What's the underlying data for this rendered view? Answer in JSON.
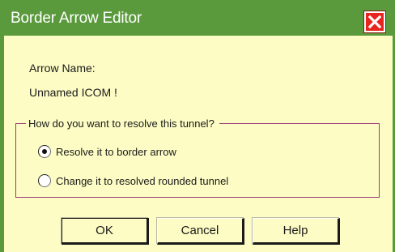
{
  "window": {
    "title": "Border Arrow Editor",
    "close_icon": "close-icon",
    "colors": {
      "titlebar": "#5a9a3c",
      "background": "#fcfcc4",
      "close_button": "#e8241f",
      "groupbox_border": "#9a3c7a"
    }
  },
  "arrow_name": {
    "label": "Arrow Name:",
    "value": "Unnamed ICOM !"
  },
  "resolve_group": {
    "legend": "How do you want to resolve this tunnel?",
    "options": [
      {
        "label": "Resolve it to border arrow",
        "selected": true
      },
      {
        "label": "Change it to resolved rounded tunnel",
        "selected": false
      }
    ]
  },
  "buttons": {
    "ok": "OK",
    "cancel": "Cancel",
    "help": "Help"
  }
}
